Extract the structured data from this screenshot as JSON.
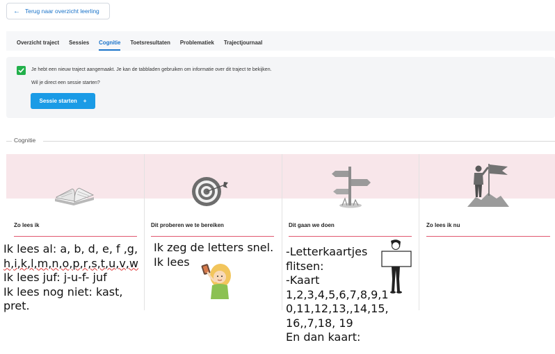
{
  "back_button": {
    "label": "Terug naar overzicht leerling"
  },
  "tabs": [
    {
      "label": "Overzicht traject",
      "active": false
    },
    {
      "label": "Sessies",
      "active": false
    },
    {
      "label": "Cognitie",
      "active": true
    },
    {
      "label": "Toetsresultaten",
      "active": false
    },
    {
      "label": "Problematiek",
      "active": false
    },
    {
      "label": "Trajectjournaal",
      "active": false
    }
  ],
  "notice": {
    "message": "Je hebt een nieuw traject aangemaakt. Je kan de tabbladen gebruiken om informatie over dit traject te bekijken.",
    "question": "Wil je direct een sessie starten?",
    "start_button": "Sessie starten",
    "start_icon": "+"
  },
  "section": {
    "title": "Cognitie"
  },
  "columns": [
    {
      "title": "Zo lees ik",
      "icon": "book-icon"
    },
    {
      "title": "Dit proberen we te bereiken",
      "icon": "target-icon"
    },
    {
      "title": "Dit gaan we doen",
      "icon": "signpost-icon"
    },
    {
      "title": "Zo lees ik nu",
      "icon": "summit-flag-icon"
    }
  ],
  "notes": {
    "col1": [
      "Ik lees al: a, b, d, e, f ,g,",
      "h,i,k,l,m,n,o,p,r,s,t,u,v,w",
      "Ik lees juf: j-u-f- juf",
      "Ik lees nog niet: kast,",
      "pret."
    ],
    "col2": [
      "Ik zeg de letters snel.",
      "Ik lees"
    ],
    "col3": [
      "-Letterkaartjes",
      "flitsen:",
      "-Kaart",
      "1,2,3,4,5,6,7,8,9,1",
      "0,11,12,13,,14,15,",
      "16,,7,18, 19",
      "En dan kaart:"
    ]
  },
  "colors": {
    "accent_blue": "#1a73c9",
    "button_blue": "#1a9be6",
    "check_green": "#22b04b",
    "pink_band": "#f8e6ea",
    "column_rule": "#e0566e"
  }
}
